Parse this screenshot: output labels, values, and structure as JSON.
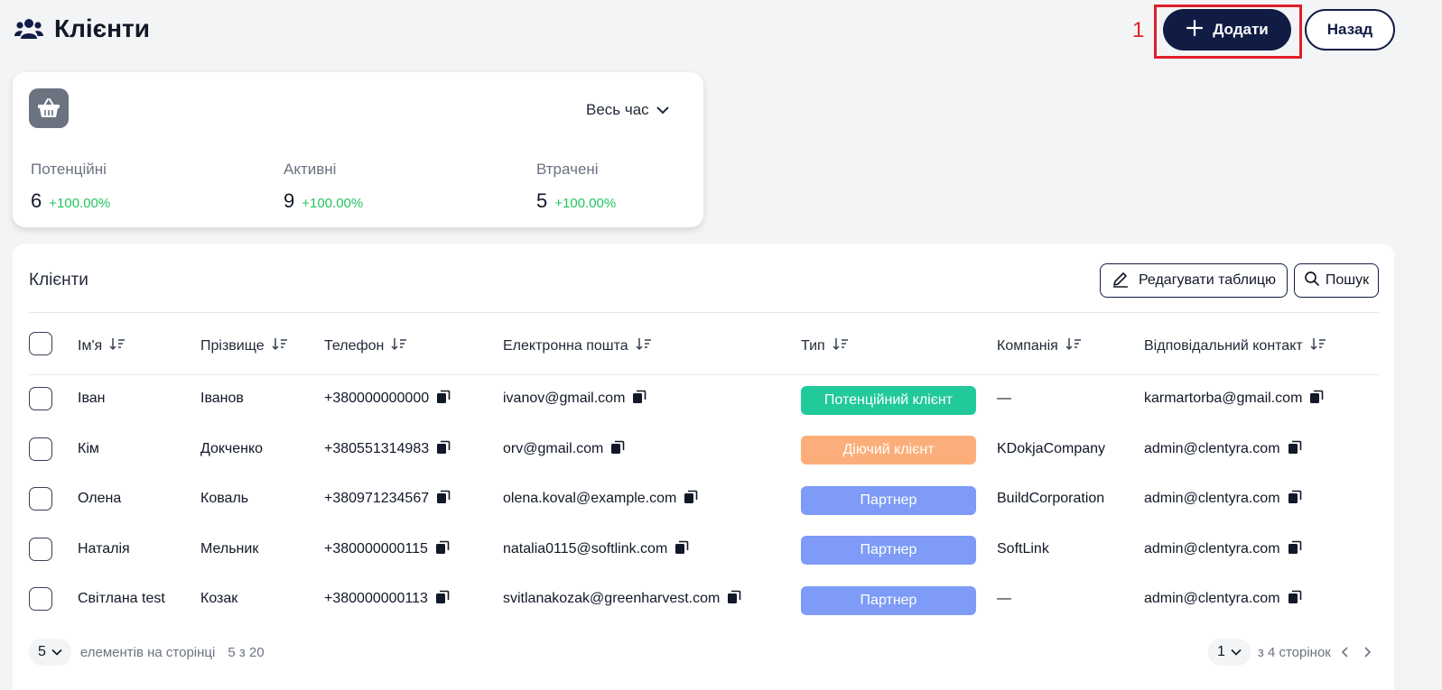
{
  "header": {
    "title": "Клієнти",
    "annotation_number": "1",
    "add_label": "Додати",
    "back_label": "Назад"
  },
  "stats": {
    "period": "Весь час",
    "items": [
      {
        "label": "Потенційні",
        "value": "6",
        "change": "+100.00%"
      },
      {
        "label": "Активні",
        "value": "9",
        "change": "+100.00%"
      },
      {
        "label": "Втрачені",
        "value": "5",
        "change": "+100.00%"
      }
    ]
  },
  "table": {
    "title": "Клієнти",
    "edit_label": "Редагувати таблицю",
    "search_label": "Пошук",
    "columns": [
      "Ім'я",
      "Прізвище",
      "Телефон",
      "Електронна пошта",
      "Тип",
      "Компанія",
      "Відповідальний контакт"
    ],
    "rows": [
      {
        "first": "Іван",
        "last": "Іванов",
        "phone": "+380000000000",
        "email": "ivanov@gmail.com",
        "type": "Потенційний клієнт",
        "type_color": "#22c99a",
        "company": "—",
        "contact": "karmartorba@gmail.com"
      },
      {
        "first": "Кім",
        "last": "Докченко",
        "phone": "+380551314983",
        "email": "orv@gmail.com",
        "type": "Діючий клієнт",
        "type_color": "#fcae7a",
        "company": "KDokjaCompany",
        "contact": "admin@clentyra.com"
      },
      {
        "first": "Олена",
        "last": "Коваль",
        "phone": "+380971234567",
        "email": "olena.koval@example.com",
        "type": "Партнер",
        "type_color": "#7d9bf7",
        "company": "BuildCorporation",
        "contact": "admin@clentyra.com"
      },
      {
        "first": "Наталія",
        "last": "Мельник",
        "phone": "+380000000115",
        "email": "natalia0115@softlink.com",
        "type": "Партнер",
        "type_color": "#7d9bf7",
        "company": "SoftLink",
        "contact": "admin@clentyra.com"
      },
      {
        "first": "Світлана test",
        "last": "Козак",
        "phone": "+380000000113",
        "email": "svitlanakozak@greenharvest.com",
        "type": "Партнер",
        "type_color": "#7d9bf7",
        "company": "—",
        "contact": "admin@clentyra.com"
      }
    ]
  },
  "pagination": {
    "page_size": "5",
    "page_size_label": "елементів на сторінці",
    "range": "5 з 20",
    "page": "1",
    "total_pages_label": "з 4 сторінок"
  },
  "colors": {
    "primary": "#111c44",
    "positive": "#22c55e",
    "highlight": "#e11d2a"
  }
}
